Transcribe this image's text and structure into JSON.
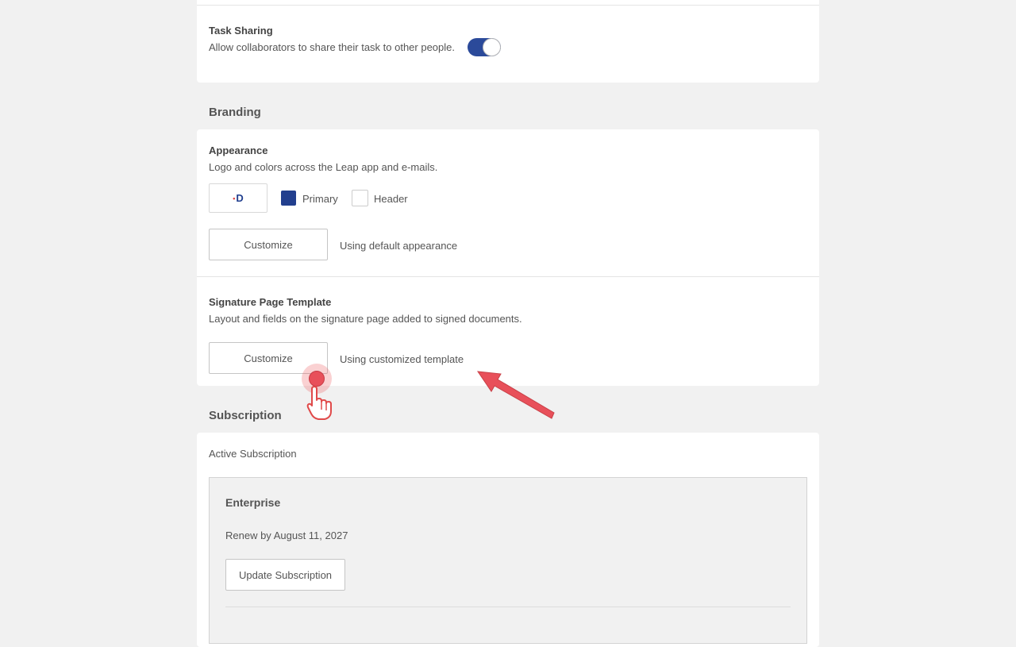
{
  "task_sharing": {
    "title": "Task Sharing",
    "description": "Allow collaborators to share their task to other people.",
    "enabled": true
  },
  "branding": {
    "heading": "Branding",
    "appearance": {
      "title": "Appearance",
      "description": "Logo and colors across the Leap app and e-mails.",
      "logo_text": "D",
      "primary_label": "Primary",
      "primary_color": "#223f8e",
      "header_label": "Header",
      "header_color": "#ffffff",
      "customize_label": "Customize",
      "status": "Using default appearance"
    },
    "signature": {
      "title": "Signature Page Template",
      "description": "Layout and fields on the signature page added to signed documents.",
      "customize_label": "Customize",
      "status": "Using customized template"
    }
  },
  "subscription": {
    "heading": "Subscription",
    "active_label": "Active Subscription",
    "plan": "Enterprise",
    "renewal": "Renew by August 11, 2027",
    "update_label": "Update Subscription"
  },
  "colors": {
    "accent": "#2b4a9a",
    "annotation": "#e8505a"
  },
  "icons": {
    "click_marker": "click-indicator-icon",
    "hand": "pointer-hand-icon",
    "arrow": "annotation-arrow-icon"
  }
}
